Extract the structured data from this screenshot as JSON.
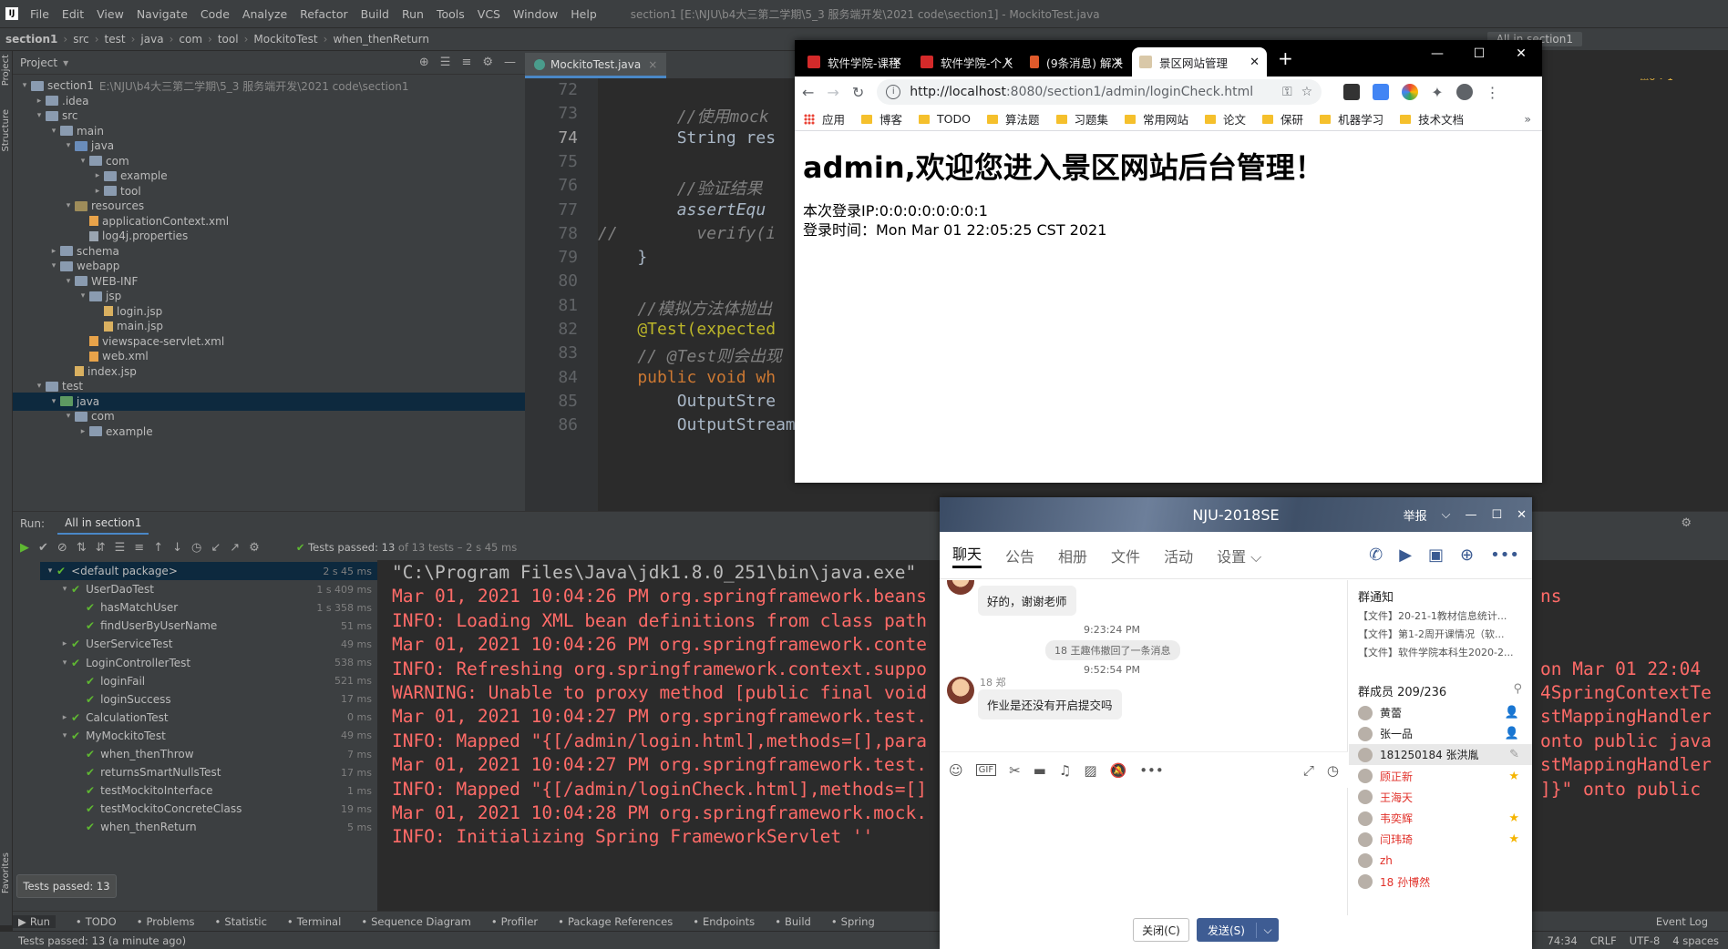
{
  "ide": {
    "menu": [
      "File",
      "Edit",
      "View",
      "Navigate",
      "Code",
      "Analyze",
      "Refactor",
      "Build",
      "Run",
      "Tools",
      "VCS",
      "Window",
      "Help"
    ],
    "window_title": "section1 [E:\\NJU\\b4大三第二学期\\5_3 服务端开发\\2021 code\\section1] - MockitoTest.java",
    "breadcrumb": [
      "section1",
      "src",
      "test",
      "java",
      "com",
      "tool",
      "MockitoTest",
      "when_thenReturn"
    ],
    "run_config": "All in section1",
    "project_label": "Project",
    "tree": [
      {
        "label": "section1",
        "sub": "E:\\NJU\\b4大三第二学期\\5_3 服务端开发\\2021 code\\section1",
        "icon": "folder",
        "depth": 0,
        "arrow": "▾"
      },
      {
        "label": ".idea",
        "icon": "folder",
        "depth": 1,
        "arrow": "▸"
      },
      {
        "label": "src",
        "icon": "folder",
        "depth": 1,
        "arrow": "▾"
      },
      {
        "label": "main",
        "icon": "folder",
        "depth": 2,
        "arrow": "▾"
      },
      {
        "label": "java",
        "icon": "folder-src",
        "depth": 3,
        "arrow": "▾"
      },
      {
        "label": "com",
        "icon": "folder",
        "depth": 4,
        "arrow": "▾"
      },
      {
        "label": "example",
        "icon": "folder",
        "depth": 5,
        "arrow": "▸"
      },
      {
        "label": "tool",
        "icon": "folder",
        "depth": 5,
        "arrow": "▸"
      },
      {
        "label": "resources",
        "icon": "folder-res",
        "depth": 3,
        "arrow": "▾"
      },
      {
        "label": "applicationContext.xml",
        "icon": "file-xml",
        "depth": 4,
        "arrow": ""
      },
      {
        "label": "log4j.properties",
        "icon": "file-prop",
        "depth": 4,
        "arrow": ""
      },
      {
        "label": "schema",
        "icon": "folder",
        "depth": 2,
        "arrow": "▸"
      },
      {
        "label": "webapp",
        "icon": "folder",
        "depth": 2,
        "arrow": "▾"
      },
      {
        "label": "WEB-INF",
        "icon": "folder",
        "depth": 3,
        "arrow": "▾"
      },
      {
        "label": "jsp",
        "icon": "folder",
        "depth": 4,
        "arrow": "▾"
      },
      {
        "label": "login.jsp",
        "icon": "file-jsp",
        "depth": 5,
        "arrow": ""
      },
      {
        "label": "main.jsp",
        "icon": "file-jsp",
        "depth": 5,
        "arrow": ""
      },
      {
        "label": "viewspace-servlet.xml",
        "icon": "file-xml",
        "depth": 4,
        "arrow": ""
      },
      {
        "label": "web.xml",
        "icon": "file-xml",
        "depth": 4,
        "arrow": ""
      },
      {
        "label": "index.jsp",
        "icon": "file-jsp",
        "depth": 3,
        "arrow": ""
      },
      {
        "label": "test",
        "icon": "folder",
        "depth": 1,
        "arrow": "▾"
      },
      {
        "label": "java",
        "icon": "folder-test",
        "depth": 2,
        "arrow": "▾",
        "selected": true
      },
      {
        "label": "com",
        "icon": "folder",
        "depth": 3,
        "arrow": "▾"
      },
      {
        "label": "example",
        "icon": "folder",
        "depth": 4,
        "arrow": "▸"
      }
    ],
    "editor_tab": "MockitoTest.java",
    "code_lines": [
      {
        "n": "72",
        "text": ""
      },
      {
        "n": "73",
        "text": "        //使用mock",
        "cls": "c-comment"
      },
      {
        "n": "74",
        "text": "        String res",
        "cls": "",
        "current": true
      },
      {
        "n": "75",
        "text": ""
      },
      {
        "n": "76",
        "text": "        //验证结果",
        "cls": "c-comment"
      },
      {
        "n": "77",
        "text": "        assertEqu",
        "cls": "c-it"
      },
      {
        "n": "78",
        "text": "//        verify(i",
        "cls": "c-comment"
      },
      {
        "n": "79",
        "text": "    }"
      },
      {
        "n": "80",
        "text": ""
      },
      {
        "n": "81",
        "text": "    //模拟方法体抛出",
        "cls": "c-comment"
      },
      {
        "n": "82",
        "text": "    @Test(expected",
        "cls": "c-ann"
      },
      {
        "n": "83",
        "text": "    // @Test则会出现",
        "cls": "c-comment"
      },
      {
        "n": "84",
        "text": "    public void wh",
        "cls": "c-kw"
      },
      {
        "n": "85",
        "text": "        OutputStre"
      },
      {
        "n": "86",
        "text": "        OutputStreamWriter writ"
      }
    ],
    "code_tail_74": ");",
    "run": {
      "label": "Run:",
      "tab": "All in section1",
      "status_main": "Tests passed: 13",
      "status_dim": " of 13 tests – 2 s 45 ms",
      "tests": [
        {
          "label": "<default package>",
          "time": "2 s 45 ms",
          "depth": 0,
          "arrow": "▾",
          "selected": true
        },
        {
          "label": "UserDaoTest",
          "time": "1 s 409 ms",
          "depth": 1,
          "arrow": "▾"
        },
        {
          "label": "hasMatchUser",
          "time": "1 s 358 ms",
          "depth": 2,
          "arrow": ""
        },
        {
          "label": "findUserByUserName",
          "time": "51 ms",
          "depth": 2,
          "arrow": ""
        },
        {
          "label": "UserServiceTest",
          "time": "49 ms",
          "depth": 1,
          "arrow": "▸"
        },
        {
          "label": "LoginControllerTest",
          "time": "538 ms",
          "depth": 1,
          "arrow": "▾"
        },
        {
          "label": "loginFail",
          "time": "521 ms",
          "depth": 2,
          "arrow": ""
        },
        {
          "label": "loginSuccess",
          "time": "17 ms",
          "depth": 2,
          "arrow": ""
        },
        {
          "label": "CalculationTest",
          "time": "0 ms",
          "depth": 1,
          "arrow": "▸"
        },
        {
          "label": "MyMockitoTest",
          "time": "49 ms",
          "depth": 1,
          "arrow": "▾"
        },
        {
          "label": "when_thenThrow",
          "time": "7 ms",
          "depth": 2,
          "arrow": ""
        },
        {
          "label": "returnsSmartNullsTest",
          "time": "17 ms",
          "depth": 2,
          "arrow": ""
        },
        {
          "label": "testMockitoInterface",
          "time": "1 ms",
          "depth": 2,
          "arrow": ""
        },
        {
          "label": "testMockitoConcreteClass",
          "time": "19 ms",
          "depth": 2,
          "arrow": ""
        },
        {
          "label": "when_thenReturn",
          "time": "5 ms",
          "depth": 2,
          "arrow": ""
        }
      ],
      "console": [
        {
          "text": "\"C:\\Program Files\\Java\\jdk1.8.0_251\\bin\\java.exe\"",
          "cmd": true
        },
        {
          "text": "Mar 01, 2021 10:04:26 PM org.springframework.beans"
        },
        {
          "text": "INFO: Loading XML bean definitions from class path"
        },
        {
          "text": "Mar 01, 2021 10:04:26 PM org.springframework.conte"
        },
        {
          "text": "INFO: Refreshing org.springframework.context.suppo"
        },
        {
          "text": "WARNING: Unable to proxy method [public final void"
        },
        {
          "text": "Mar 01, 2021 10:04:27 PM org.springframework.test."
        },
        {
          "text": "INFO: Mapped \"{[/admin/login.html],methods=[],para"
        },
        {
          "text": "Mar 01, 2021 10:04:27 PM org.springframework.test."
        },
        {
          "text": "INFO: Mapped \"{[/admin/loginCheck.html],methods=[]"
        },
        {
          "text": "Mar 01, 2021 10:04:28 PM org.springframework.mock."
        },
        {
          "text": "INFO: Initializing Spring FrameworkServlet ''"
        }
      ],
      "console_right": [
        {
          "text": "ns",
          "line": 1
        },
        {
          "text": "on Mar 01 22:04",
          "line": 4
        },
        {
          "text": "4SpringContextTe",
          "line": 5
        },
        {
          "text": "stMappingHandler",
          "line": 6
        },
        {
          "text": "onto public java",
          "line": 7
        },
        {
          "text": "stMappingHandler",
          "line": 8
        },
        {
          "text": "]}\" onto public",
          "line": 9
        }
      ],
      "tooltip": "Tests passed: 13"
    },
    "bottom_tabs": [
      "Run",
      "TODO",
      "Problems",
      "Statistic",
      "Terminal",
      "Sequence Diagram",
      "Profiler",
      "Package References",
      "Endpoints",
      "Build",
      "Spring"
    ],
    "event_log": "Event Log",
    "status_left": "Tests passed: 13 (a minute ago)",
    "status_right": [
      "74:34",
      "CRLF",
      "UTF-8",
      "4 spaces"
    ],
    "inspections": "⚠6  ✓1"
  },
  "browser": {
    "tabs": [
      {
        "label": "软件学院-课程",
        "favicon_color": "#d42a2a"
      },
      {
        "label": "软件学院-个人",
        "favicon_color": "#d42a2a"
      },
      {
        "label": "(9条消息) 解决",
        "favicon_color": "#e05a2b"
      },
      {
        "label": "景区网站管理",
        "favicon_color": "#d9c8a8",
        "active": true
      }
    ],
    "url_host": "http://localhost",
    "url_path": ":8080/section1/admin/loginCheck.html",
    "bookmarks": [
      "应用",
      "博客",
      "TODO",
      "算法题",
      "习题集",
      "常用网站",
      "论文",
      "保研",
      "机器学习",
      "技术文档"
    ],
    "page": {
      "heading": "admin,欢迎您进入景区网站后台管理！",
      "ip_line": "本次登录IP:0:0:0:0:0:0:0:1",
      "time_line": "登录时间：Mon Mar 01 22:05:25 CST 2021"
    }
  },
  "qq": {
    "title": "NJU-2018SE",
    "report": "举报",
    "nav": [
      "聊天",
      "公告",
      "相册",
      "文件",
      "活动",
      "设置 ⌵"
    ],
    "messages": {
      "m1": "好的，谢谢老师",
      "ts1": "9:23:24 PM",
      "sys1": "18 王趣伟撤回了一条消息",
      "ts2": "9:52:54 PM",
      "sender2": "18 郑",
      "m2": "作业是还没有开启提交吗"
    },
    "notice_title": "群通知",
    "notices": [
      "【文件】20-21-1教材信息统计...",
      "【文件】第1-2周开课情况（软...",
      "【文件】软件学院本科生2020-2..."
    ],
    "members_title": "群成员 209/236",
    "members": [
      {
        "name": "黄蕾",
        "red": false,
        "badge": "👤"
      },
      {
        "name": "张一品",
        "red": false,
        "badge": "👤"
      },
      {
        "name": "181250184 张洪胤",
        "red": false,
        "badge": "✎",
        "sel": true
      },
      {
        "name": "顾正新",
        "red": true,
        "badge": "★"
      },
      {
        "name": "王海天",
        "red": true,
        "badge": ""
      },
      {
        "name": "韦奕辉",
        "red": true,
        "badge": "★"
      },
      {
        "name": "闫玮琦",
        "red": true,
        "badge": "★"
      },
      {
        "name": "zh",
        "red": true,
        "badge": ""
      },
      {
        "name": "18 孙博然",
        "red": true,
        "badge": ""
      }
    ],
    "close_label": "关闭(C)",
    "send_label": "发送(S)"
  }
}
